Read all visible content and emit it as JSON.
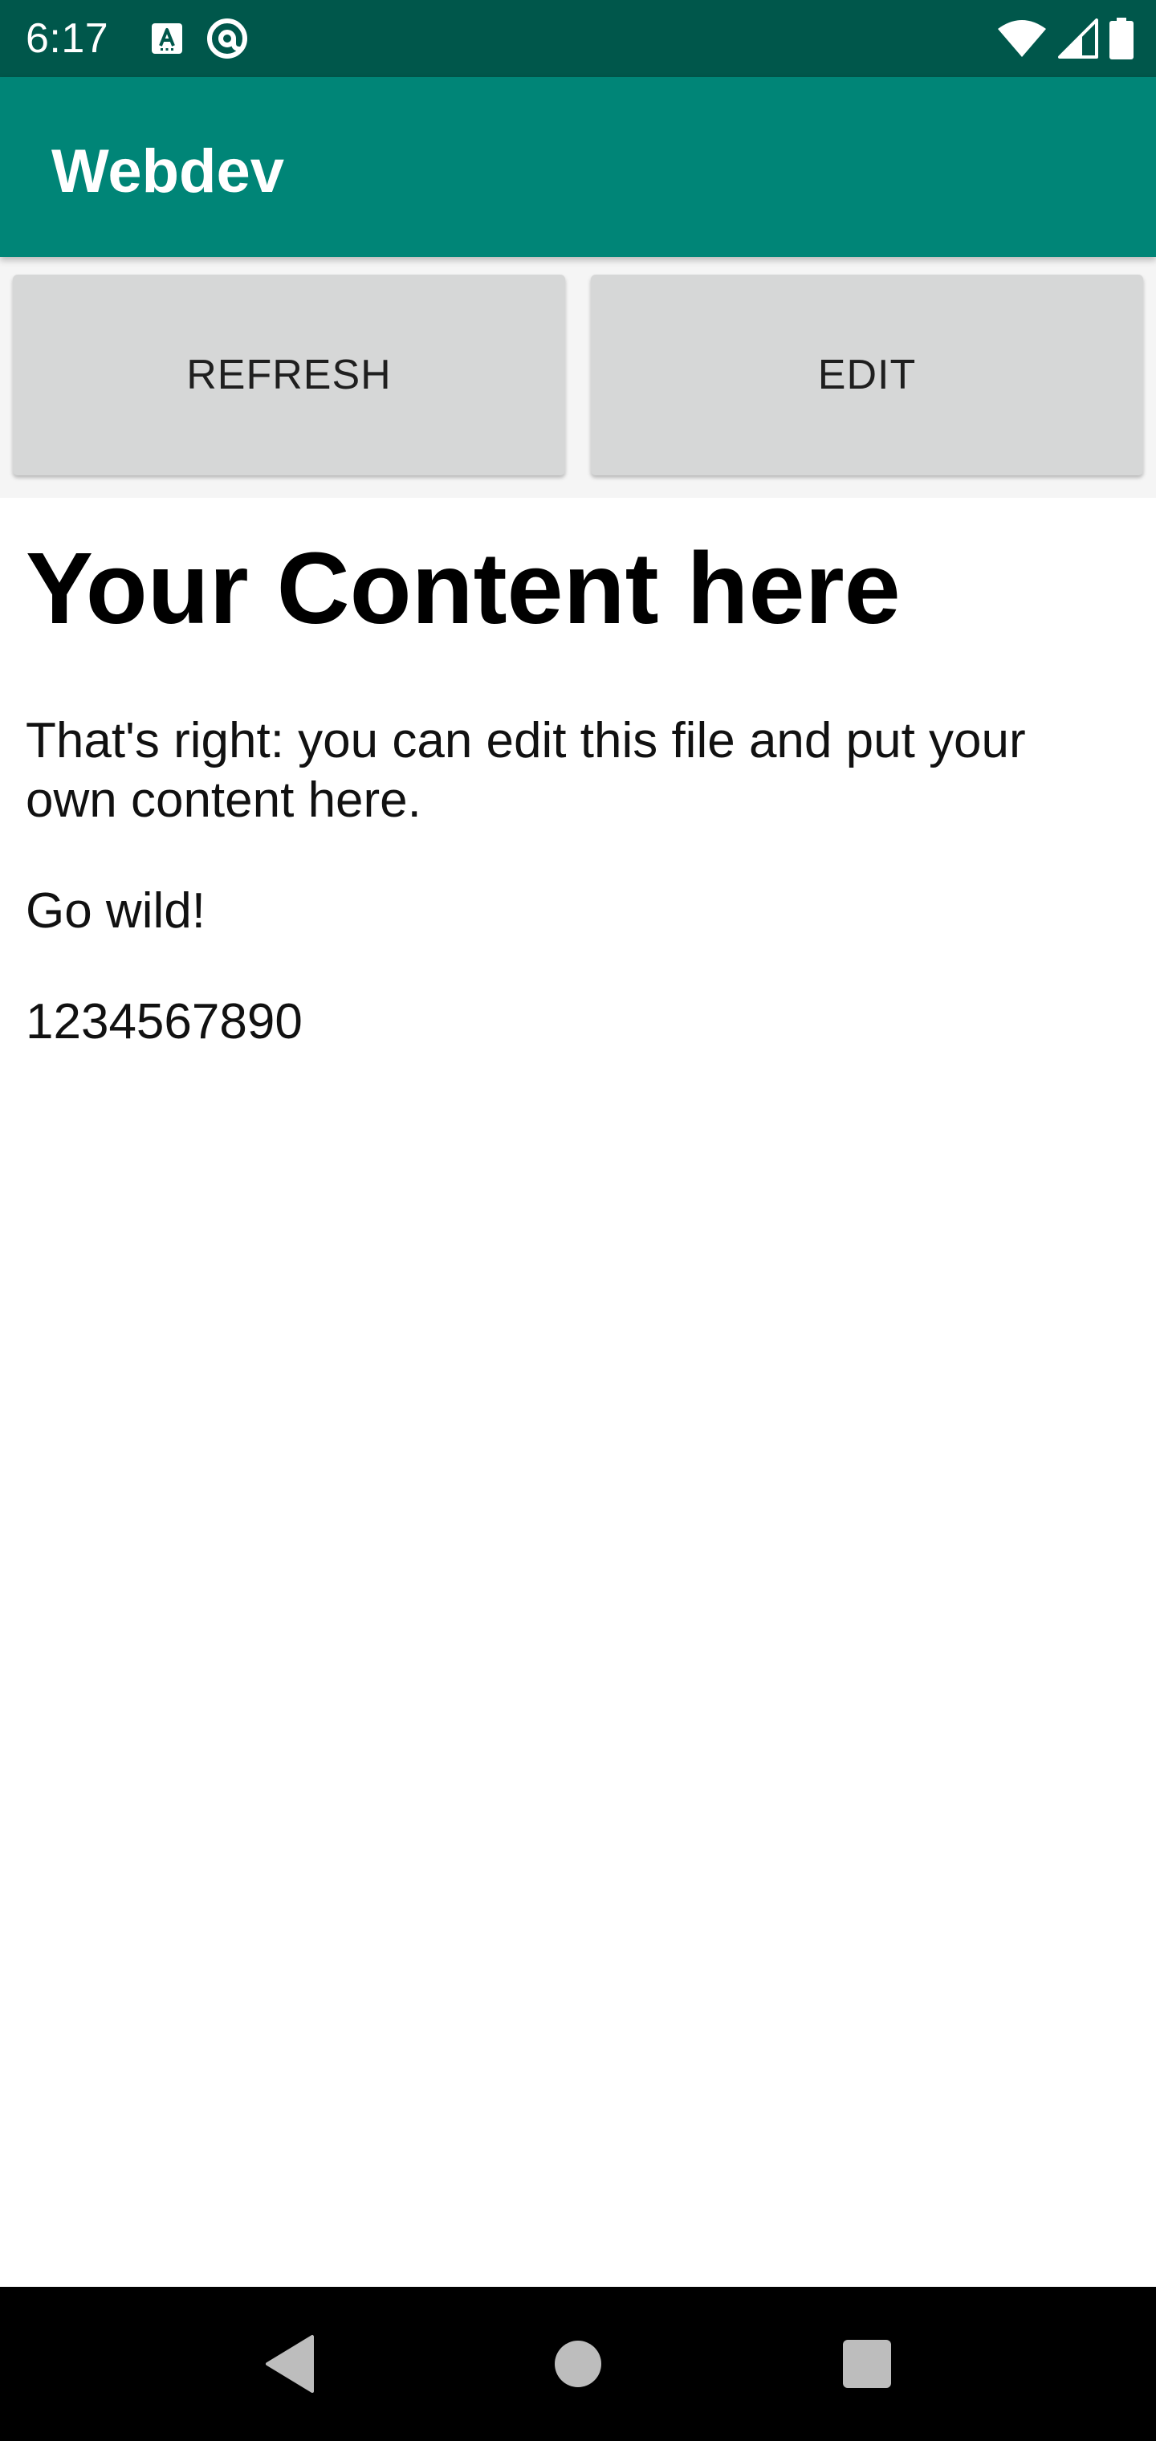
{
  "status_bar": {
    "time": "6:17",
    "left_icons": [
      "keyboard-a-icon",
      "at-sign-icon"
    ],
    "right_icons": [
      "wifi-icon",
      "cellular-signal-icon",
      "battery-icon"
    ],
    "background_color": "#00574B"
  },
  "app_bar": {
    "title": "Webdev",
    "background_color": "#008577"
  },
  "buttons": {
    "refresh_label": "REFRESH",
    "edit_label": "EDIT"
  },
  "content": {
    "heading": "Your Content here",
    "paragraph_1": "That's right: you can edit this file and put your own content here.",
    "paragraph_2": "Go wild!",
    "paragraph_3": "1234567890"
  },
  "nav_bar": {
    "icons": [
      "back-triangle-icon",
      "home-circle-icon",
      "recents-square-icon"
    ]
  }
}
